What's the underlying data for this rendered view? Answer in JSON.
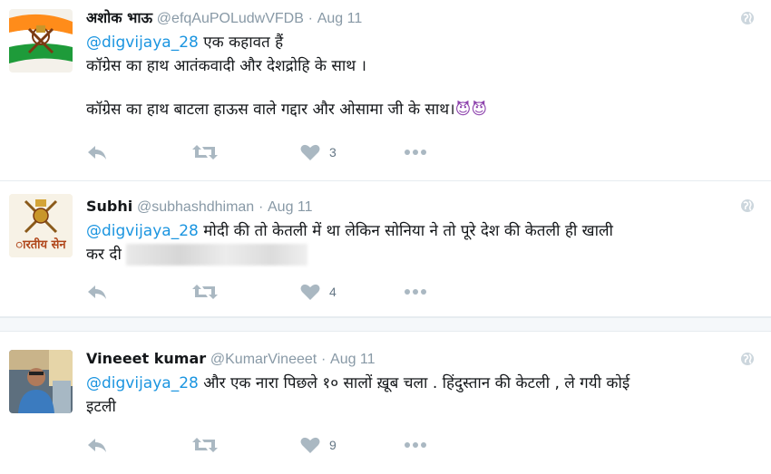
{
  "tweets": [
    {
      "name": "अशोक भाऊ",
      "handle": "@efqAuPOLudwVFDB",
      "separator": "·",
      "time": "Aug 11",
      "mention": "@digvijaya_28",
      "line1": " एक कहावत हैं",
      "line2": "कॉग्रेस का हाथ आतंकवादी और देशद्रोहि के साथ ।",
      "line3": "कॉग्रेस का हाथ बाटला हाऊस वाले गद्दार और ओसामा जी के साथ।",
      "emoji": "😈😈",
      "likes": "3",
      "avatar_icon": "indian-army-flag-emblem"
    },
    {
      "name": "Subhi",
      "handle": "@subhashdhiman",
      "separator": "·",
      "time": "Aug 11",
      "mention": "@digvijaya_28",
      "line1": " मोदी की तो केतली में था लेकिन सोनिया ने तो पूरे देश की केतली ही खाली",
      "line2": "कर दी",
      "likes": "4",
      "avatar_icon": "indian-army-emblem",
      "avatar_text": "ारतीय सेन"
    },
    {
      "name": "Vineeet kumar",
      "handle": "@KumarVineeet",
      "separator": "·",
      "time": "Aug 11",
      "mention": "@digvijaya_28",
      "line1": " और एक नारा पिछले १० सालों ख़ूब चला . हिंदुस्तान की केटली , ले गयी कोई",
      "line2": "इटली",
      "likes": "9",
      "avatar_icon": "person-photo"
    }
  ],
  "colors": {
    "link": "#1b95e0",
    "muted": "#8899a6",
    "icon": "#aab8c2",
    "divider": "#f5f8fa"
  }
}
